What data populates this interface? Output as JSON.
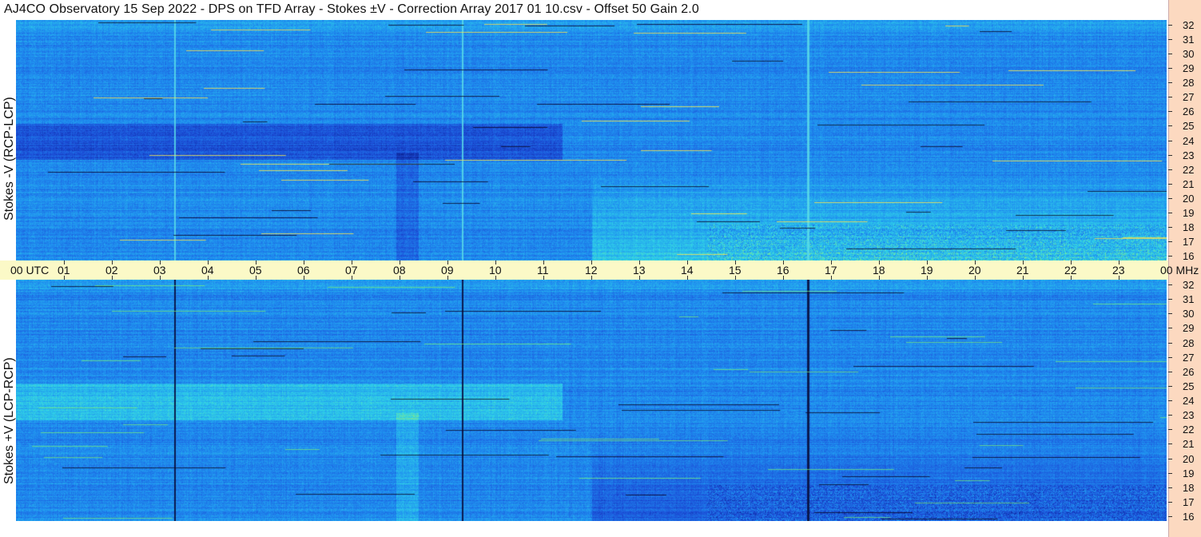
{
  "title": "AJ4CO Observatory  15 Sep 2022  -  DPS on TFD Array  -  Stokes ±V  -  Correction Array 2017 01 10.csv  -  Offset 50  Gain 2.0",
  "chart_data": {
    "type": "heatmap",
    "x_axis": {
      "unit_label_start": "00  UTC",
      "unit_label_end": "00 MHz",
      "tick_labels": [
        "01",
        "02",
        "03",
        "04",
        "05",
        "06",
        "07",
        "08",
        "09",
        "10",
        "11",
        "12",
        "13",
        "14",
        "15",
        "16",
        "17",
        "18",
        "19",
        "20",
        "21",
        "22",
        "23"
      ],
      "range_hours": [
        0,
        24
      ]
    },
    "y_axis": {
      "tick_labels": [
        "32",
        "31",
        "30",
        "29",
        "28",
        "27",
        "26",
        "25",
        "24",
        "23",
        "22",
        "21",
        "20",
        "19",
        "18",
        "17",
        "16"
      ],
      "range_mhz": [
        16,
        32
      ]
    },
    "panels": [
      {
        "ylabel": "Stokes -V (RCP-LCP)",
        "polarity": "minus"
      },
      {
        "ylabel": "Stokes +V (LCP-RCP)",
        "polarity": "plus"
      }
    ],
    "colormap": [
      "#0a1f8f",
      "#1c4fd8",
      "#1f8ff0",
      "#2fd1e8",
      "#9ef070",
      "#f0e040"
    ]
  }
}
